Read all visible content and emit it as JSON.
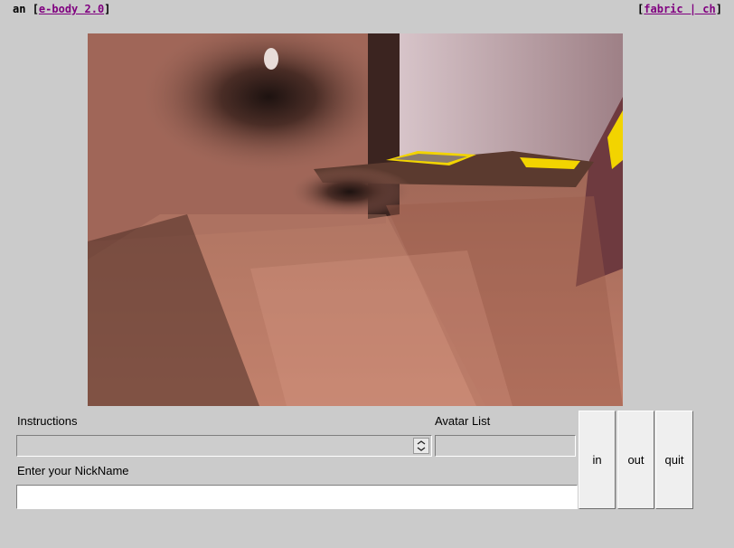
{
  "header": {
    "left_prefix": "an",
    "left_link": "e-body 2.0",
    "right_link": "fabric | ch"
  },
  "viewport": {
    "description_icon": "3d-scene-view"
  },
  "instructions": {
    "label": "Instructions",
    "value": ""
  },
  "avatar_list": {
    "label": "Avatar List",
    "value": ""
  },
  "nickname": {
    "label": "Enter your NickName",
    "value": ""
  },
  "buttons": {
    "in": "in",
    "out": "out",
    "quit": "quit"
  },
  "colors": {
    "background": "#cbcbcb",
    "link": "#800080",
    "accent_yellow": "#f2d400"
  }
}
